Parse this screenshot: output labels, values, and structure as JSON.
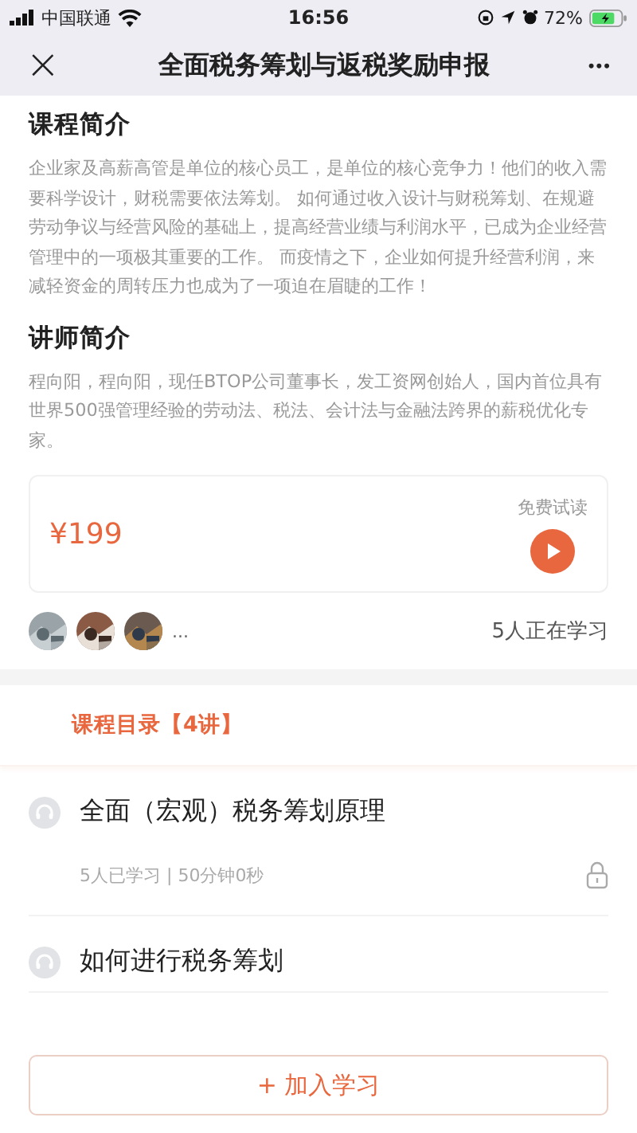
{
  "status_bar": {
    "carrier": "中国联通",
    "time": "16:56",
    "battery": "72%"
  },
  "nav": {
    "close": "×",
    "title": "全面税务筹划与返税奖励申报",
    "more": "•••"
  },
  "sections": [
    {
      "heading": "课程简介",
      "text": "企业家及高薪高管是单位的核心员工，是单位的核心竞争力！他们的收入需要科学设计，财税需要依法筹划。 如何通过收入设计与财税筹划、在规避劳动争议与经营风险的基础上，提高经营业绩与利润水平，已成为企业经营管理中的一项极其重要的工作。 而疫情之下，企业如何提升经营利润，来减轻资金的周转压力也成为了一项迫在眉睫的工作！"
    },
    {
      "heading": "讲师简介",
      "text": "程向阳，程向阳，现任BTOP公司董事长，发工资网创始人，国内首位具有世界500强管理经验的劳动法、税法、会计法与金融法跨界的薪税优化专家。"
    }
  ],
  "price_card": {
    "price": "¥199",
    "trial_label": "免费试读"
  },
  "learners": {
    "more": "...",
    "count": "5人正在学习"
  },
  "catalog": {
    "title": "课程目录【4讲】",
    "lessons": [
      {
        "title": "全面（宏观）税务筹划原理",
        "meta": "5人已学习 | 50分钟0秒",
        "locked": true
      },
      {
        "title": "如何进行税务筹划",
        "locked": false
      }
    ]
  },
  "join_button": "+ 加入学习"
}
